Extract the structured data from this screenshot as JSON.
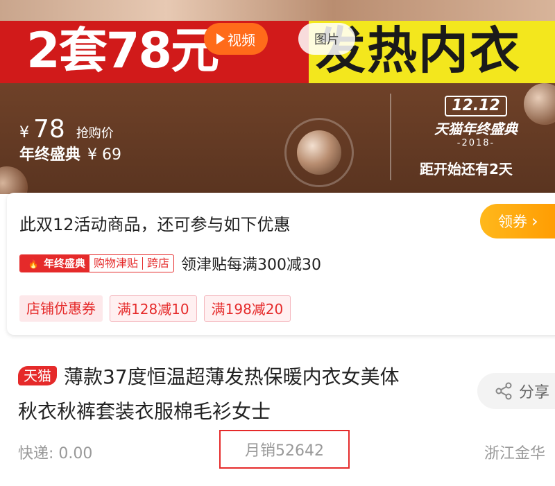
{
  "hero": {
    "banner_left": "2套78元",
    "banner_right": "发热内衣",
    "video_label": "视频",
    "image_label": "图片",
    "price_currency": "¥",
    "price_value": "78",
    "price_tag": "抢购价",
    "event_price_label": "年终盛典",
    "event_price": "¥ 69",
    "event_logo": {
      "date": "12.12",
      "name": "天猫年终盛典",
      "year": "-2018-"
    },
    "countdown": "距开始还有2天",
    "colors": {
      "banner_red": "#d11a1a",
      "banner_yellow": "#f3e71d",
      "video_orange": "#ff6b1a"
    }
  },
  "promo": {
    "title": "此双12活动商品，还可参与如下优惠",
    "coupon_button": "领券",
    "subsidy_badge": {
      "event": "年终盛典",
      "segment1": "购物津贴",
      "segment2": "跨店"
    },
    "subsidy_text": "领津贴每满300减30",
    "coupons": [
      "店铺优惠券",
      "满128减10",
      "满198减20"
    ],
    "colors": {
      "accent_red": "#e52a2a",
      "coupon_orange": "#ff9a00"
    }
  },
  "product": {
    "badge": "天猫",
    "title_line1": "薄款37度恒温超薄发热保暖内衣女美体",
    "title_line2": "秋衣秋裤套装衣服棉毛衫女士",
    "share_label": "分享",
    "shipping": "快递: 0.00",
    "monthly_sales": "月销52642",
    "location": "浙江金华"
  }
}
